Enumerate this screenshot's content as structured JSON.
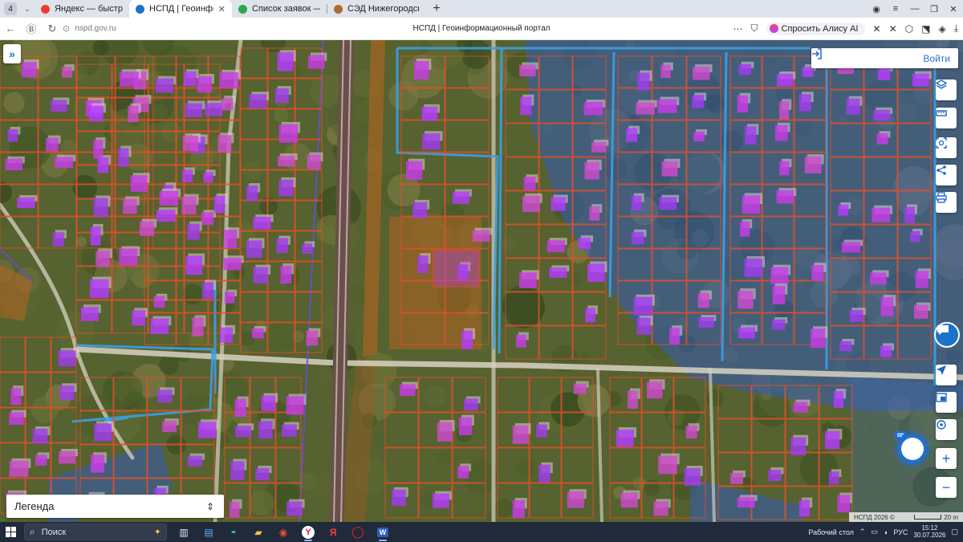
{
  "browser": {
    "tab_count": "4",
    "tabs": [
      {
        "title": "Яндекс — быстрый поиск",
        "favicon_color": "#f33a2f",
        "active": false
      },
      {
        "title": "НСПД | Геоинформаци",
        "favicon_color": "#1a73c9",
        "active": true
      },
      {
        "title": "Список заявок — ТехноК",
        "favicon_color": "#2ea44f",
        "active": false
      },
      {
        "title": "СЭД Нижегородская обл",
        "favicon_color": "#b06a2a",
        "active": false
      }
    ],
    "url": "nspd.gov.ru",
    "page_title": "НСПД | Геоинформационный портал",
    "alice_label": "Спросить Алису AI"
  },
  "map": {
    "login_label": "Войти",
    "legend_label": "Легенда",
    "copyright": "НСПД 2026 ©",
    "scale_label": "20 m",
    "colors": {
      "parcel_outline": "#e0502a",
      "building": "#b63cff",
      "zone_blue": "#2f5bd8",
      "zone_orange": "#c8641e",
      "water_line": "#3aa0e6",
      "road": "#d8d2c2"
    },
    "tools": [
      "layers-icon",
      "ruler-icon",
      "select-area-icon",
      "share-icon",
      "print-icon"
    ],
    "bottom_tools": [
      "locate-icon",
      "minimap-icon",
      "gps-icon",
      "zoom-in-icon",
      "zoom-out-icon"
    ]
  },
  "taskbar": {
    "search_placeholder": "Поиск",
    "desktop_label": "Рабочий стол",
    "language": "РУС",
    "time": "15:12",
    "date": "30.07.2026"
  }
}
